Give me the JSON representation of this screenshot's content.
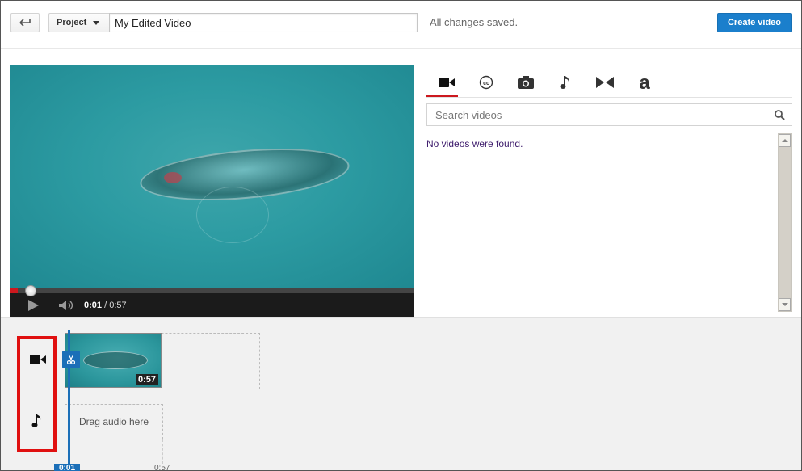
{
  "header": {
    "project_label": "Project",
    "title_value": "My Edited Video",
    "save_status": "All changes saved.",
    "create_label": "Create video"
  },
  "player": {
    "current_time": "0:01",
    "separator": " / ",
    "duration": "0:57",
    "progress_fraction": 0.018
  },
  "panel": {
    "tabs": [
      {
        "icon": "video-camera-icon",
        "active": true
      },
      {
        "icon": "closed-caption-icon",
        "active": false
      },
      {
        "icon": "photo-camera-icon",
        "active": false
      },
      {
        "icon": "music-note-icon",
        "active": false
      },
      {
        "icon": "bowtie-transitions-icon",
        "active": false
      },
      {
        "icon": "text-a-icon",
        "active": false
      }
    ],
    "search_placeholder": "Search videos",
    "empty_message": "No videos were found."
  },
  "timeline": {
    "clip_duration": "0:57",
    "audio_placeholder": "Drag audio here",
    "playhead_time": "0:01",
    "end_time": "0:57"
  },
  "colors": {
    "accent_blue": "#1b7fcc",
    "active_red": "#cc181e",
    "highlight_red": "#e01010"
  }
}
